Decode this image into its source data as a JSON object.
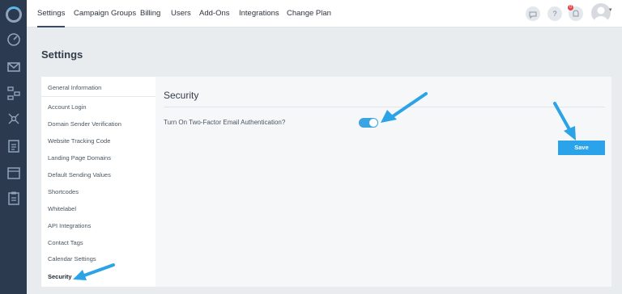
{
  "topnav": {
    "tabs": [
      {
        "label": "Settings"
      },
      {
        "label": "Campaign Groups"
      },
      {
        "label": "Billing"
      },
      {
        "label": "Users"
      },
      {
        "label": "Add-Ons"
      },
      {
        "label": "Integrations"
      },
      {
        "label": "Change Plan"
      }
    ],
    "help_label": "?",
    "notification_count": "0"
  },
  "page": {
    "title": "Settings"
  },
  "sidenav": {
    "items": [
      {
        "label": "General Information"
      },
      {
        "label": "Account Login"
      },
      {
        "label": "Domain Sender Verification"
      },
      {
        "label": "Website Tracking Code"
      },
      {
        "label": "Landing Page Domains"
      },
      {
        "label": "Default Sending Values"
      },
      {
        "label": "Shortcodes"
      },
      {
        "label": "Whitelabel"
      },
      {
        "label": "API Integrations"
      },
      {
        "label": "Contact Tags"
      },
      {
        "label": "Calendar Settings"
      },
      {
        "label": "Security"
      }
    ],
    "active": "Security"
  },
  "security": {
    "title": "Security",
    "two_factor_label": "Turn On Two-Factor Email Authentication?",
    "two_factor_enabled": true,
    "save_label": "Save"
  },
  "colors": {
    "rail": "#2c3a4f",
    "accent": "#2aa3ea",
    "annotation_arrow": "#2ba3e6"
  }
}
